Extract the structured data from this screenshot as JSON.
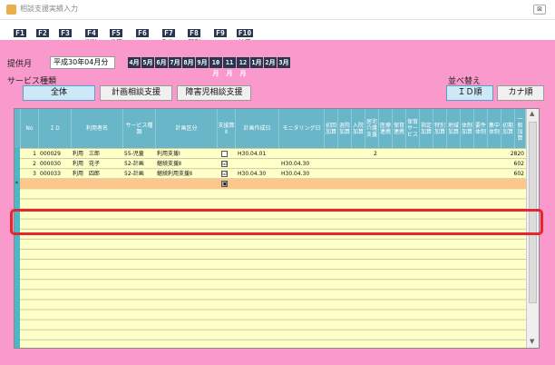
{
  "window": {
    "title": "相談支援実績入力",
    "close_label": "⊠"
  },
  "toolbar": [
    {
      "key": "F1",
      "label": ""
    },
    {
      "key": "F2",
      "label": ""
    },
    {
      "key": "F3",
      "label": ""
    },
    {
      "key": "F4",
      "label": "削除"
    },
    {
      "key": "F5",
      "label": "参照"
    },
    {
      "key": "F6",
      "label": ""
    },
    {
      "key": "F7",
      "label": "取込"
    },
    {
      "key": "F8",
      "label": "印刷"
    },
    {
      "key": "F9",
      "label": ""
    },
    {
      "key": "F10",
      "label": "終了"
    }
  ],
  "period": {
    "label": "提供月",
    "value": "平成30年04月分"
  },
  "months": [
    "4月",
    "5月",
    "6月",
    "7月",
    "8月",
    "9月",
    "10月",
    "11月",
    "12月",
    "1月",
    "2月",
    "3月"
  ],
  "service_filter": {
    "label": "サービス種類",
    "buttons": [
      "全体",
      "計画相談支援",
      "障害児相談支援"
    ],
    "selected": "全体"
  },
  "sort": {
    "label": "並べ替え",
    "buttons": [
      "ＩＤ順",
      "カナ順"
    ],
    "selected": "ＩＤ順"
  },
  "grid": {
    "columns": [
      "No",
      "ＩＤ",
      "利用者名",
      "サービス種類",
      "計画区分",
      "支援算Ⅱ",
      "計画作成日",
      "モニタリング日",
      "初回加算",
      "退院加算",
      "入院加算",
      "居宅介護支援",
      "医療連携",
      "保育連携",
      "保育サービス",
      "指定加算",
      "特別加算",
      "地域加算",
      "体制加算",
      "要件体制",
      "集中体制",
      "初期加算",
      "一般加算",
      "単位数"
    ],
    "rows": [
      {
        "no": "1",
        "id": "000029",
        "name": "利用　三郎",
        "service": "55-児童",
        "kubun": "利用支援Ⅰ",
        "support": "",
        "plan_date": "H30.04.01",
        "monitor_date": "",
        "count": "2",
        "units": "2820"
      },
      {
        "no": "2",
        "id": "000030",
        "name": "利用　花子",
        "service": "52-計画",
        "kubun": "継続支援Ⅱ",
        "support": "☑",
        "plan_date": "",
        "monitor_date": "H30.04.30",
        "count": "",
        "units": "602"
      },
      {
        "no": "3",
        "id": "000033",
        "name": "利用　四郎",
        "service": "52-計画",
        "kubun": "継続利用支援Ⅱ",
        "support": "☑",
        "plan_date": "H30.04.30",
        "monitor_date": "H30.04.30",
        "count": "",
        "units": "602"
      }
    ],
    "new_row": {
      "marker": "*",
      "support": "▣"
    }
  },
  "colors": {
    "background": "#fa99cc",
    "header": "#6ab6c9",
    "grid": "#ffffc8",
    "highlight": "#fcc78c",
    "annotation": "#e4262f"
  }
}
